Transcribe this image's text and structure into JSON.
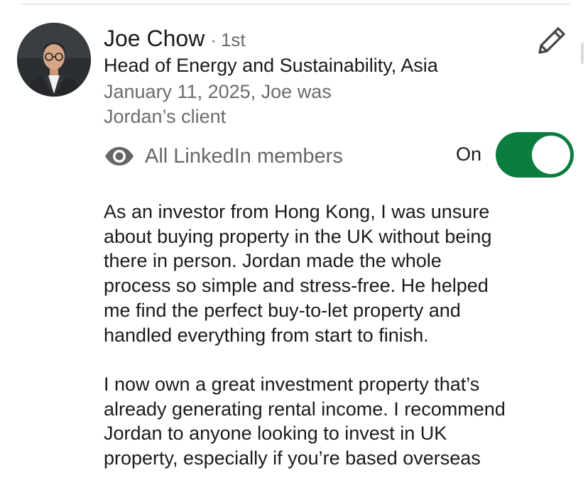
{
  "recommender": {
    "name": "Joe Chow",
    "separator": "·",
    "degree": "1st",
    "headline": "Head of Energy and Sustainability, Asia",
    "meta_lines": [
      "January 11, 2025, Joe was",
      "Jordan’s client"
    ]
  },
  "visibility": {
    "icon": "eye-icon",
    "label": "All LinkedIn members",
    "toggle_label": "On",
    "toggle_on": true,
    "toggle_color": "#0b7d3e"
  },
  "edit": {
    "icon": "pencil-icon"
  },
  "recommendation": {
    "paragraphs": [
      [
        "As an investor from Hong Kong, I was unsure",
        "about buying property in the UK without being",
        "there in person. Jordan made the whole",
        "process so simple and stress-free. He helped",
        "me find the perfect buy-to-let property and",
        "handled everything from start to finish."
      ],
      [
        "I now own a great investment property that’s",
        "already generating rental income. I recommend",
        "Jordan to anyone looking to invest in UK",
        "property, especially if you’re based overseas"
      ]
    ]
  }
}
